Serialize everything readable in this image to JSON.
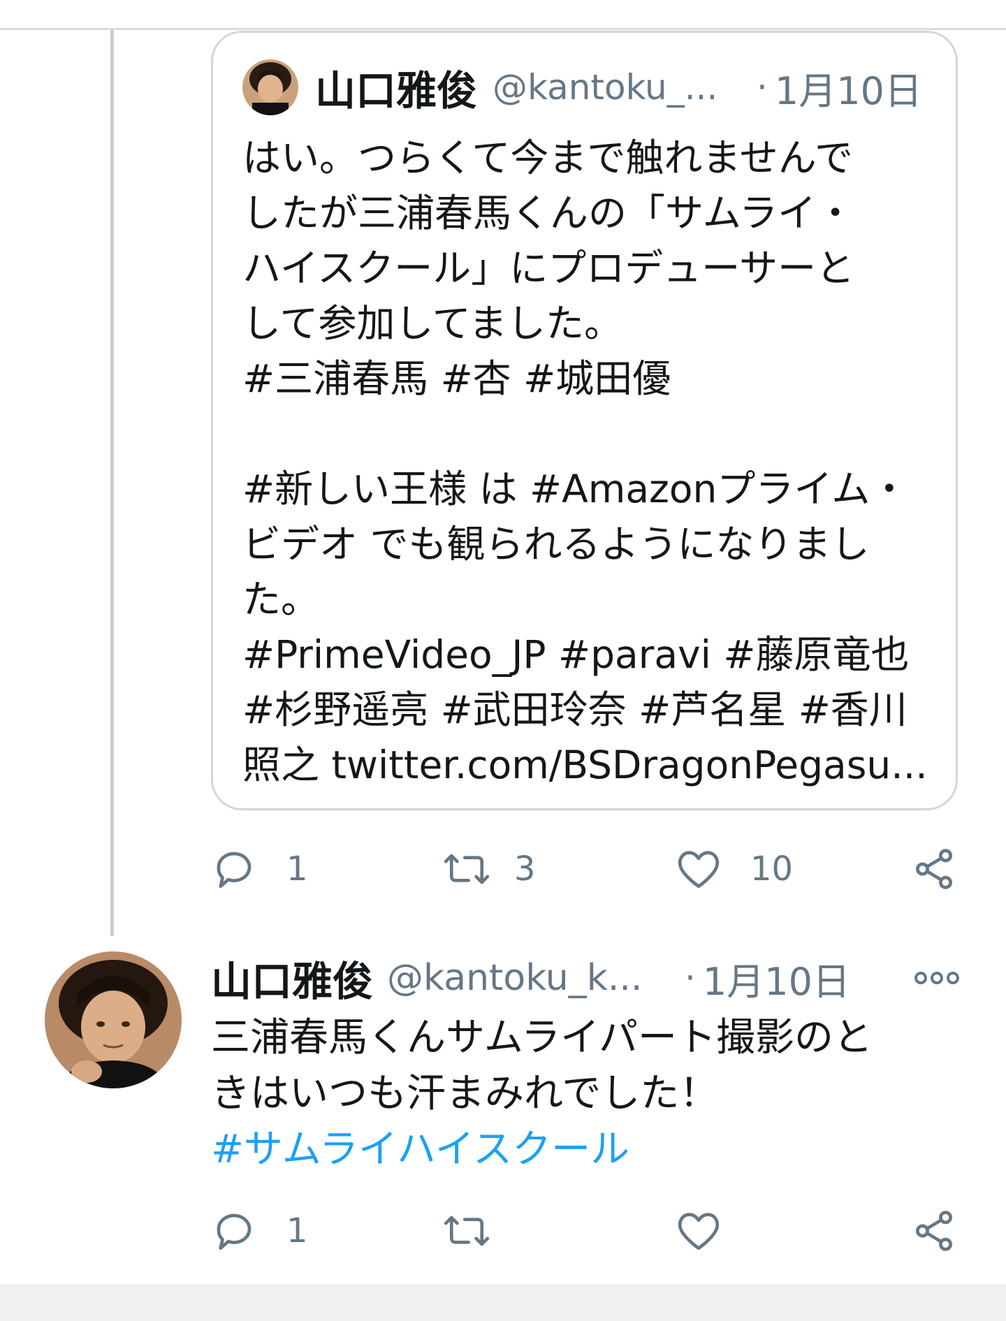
{
  "quoted_tweet": {
    "display_name": "山口雅俊",
    "handle": "@kantoku_...",
    "dot": "·",
    "date": "1月10日",
    "body_lines": [
      "はい。つらくて今まで触れませんで",
      "したが三浦春馬くんの「サムライ・",
      "ハイスクール」にプロデューサーと",
      "して参加してました。",
      "#三浦春馬 #杏 #城田優",
      "",
      "#新しい王様 は #Amazonプライム・",
      "ビデオ でも観られるようになりまし",
      "た。",
      "#PrimeVideo_JP #paravi #藤原竜也",
      "#杉野遥亮 #武田玲奈 #芦名星 #香川",
      "照之 twitter.com/BSDragonPegasu..."
    ]
  },
  "quoted_actions": {
    "reply_icon": "reply-icon",
    "reply_count": "1",
    "retweet_icon": "retweet-icon",
    "retweet_count": "3",
    "like_icon": "heart-icon",
    "like_count": "10",
    "share_icon": "share-icon"
  },
  "tweet": {
    "display_name": "山口雅俊",
    "handle": "@kantoku_k...",
    "dot": "·",
    "date": "1月10日",
    "more_icon": "more-icon",
    "body_line_1": "三浦春馬くんサムライパート撮影のと",
    "body_line_2": "きはいつも汗まみれでした！",
    "hashtag": "#サムライハイスクール",
    "hashtag_color": "#1da1f2"
  },
  "tweet_actions": {
    "reply_icon": "reply-icon",
    "reply_count": "1",
    "retweet_icon": "retweet-icon",
    "like_icon": "heart-icon",
    "share_icon": "share-icon"
  },
  "colors": {
    "text": "#14171a",
    "muted": "#657786",
    "border": "#d2d7db",
    "link": "#1da1f2"
  }
}
